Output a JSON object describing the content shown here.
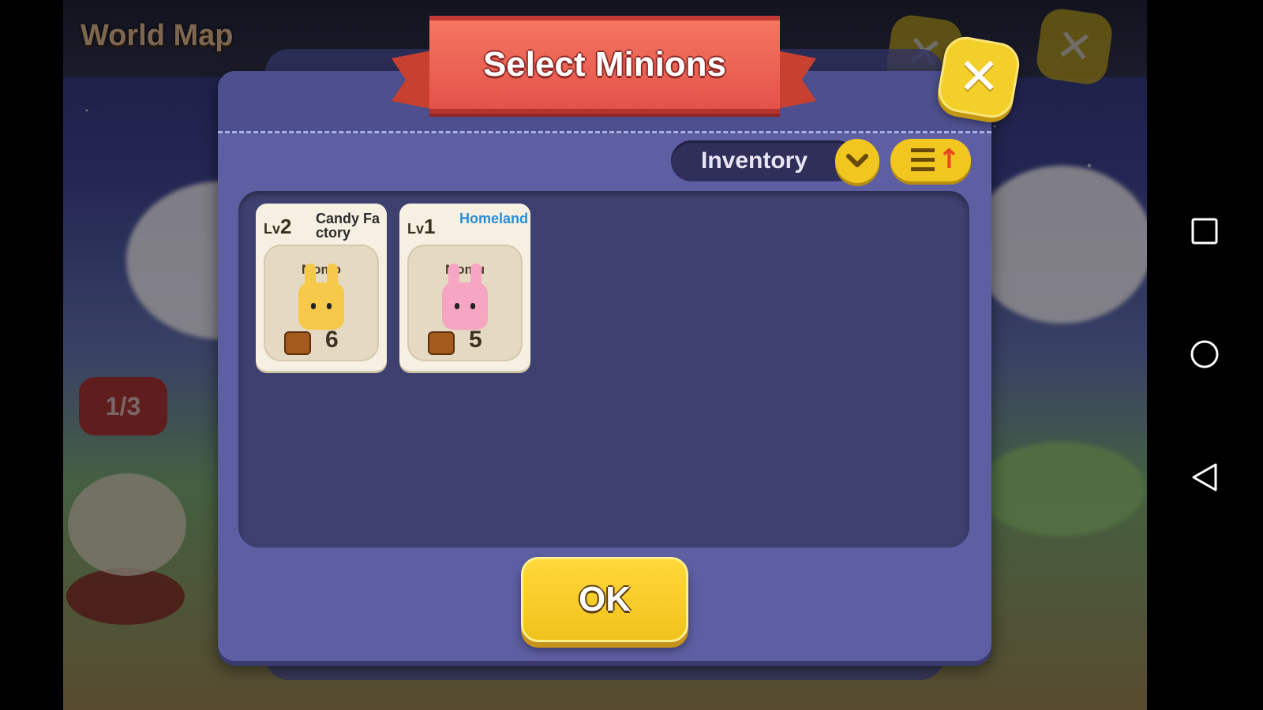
{
  "background": {
    "header_title": "World Map",
    "page_indicator": "1/3",
    "close_icon": "close-icon"
  },
  "dialog": {
    "title": "Select Minions",
    "close_icon": "close-icon",
    "filter": {
      "selected": "Inventory",
      "dropdown_icon": "chevron-down-icon"
    },
    "sort_icon": "sort-ascending-icon",
    "minions": [
      {
        "level_prefix": "Lv",
        "level": "2",
        "location": "Candy Factory",
        "location_color": "#2b2b2b",
        "name": "Momo",
        "count": "6",
        "body_color": "#f6c94a",
        "icon": "treasure-chest-icon"
      },
      {
        "level_prefix": "Lv",
        "level": "1",
        "location": "Homeland",
        "location_color": "#2a8dd8",
        "name": "Momu",
        "count": "5",
        "body_color": "#f6a6c2",
        "icon": "treasure-chest-icon"
      }
    ],
    "ok_label": "OK"
  },
  "system_nav": {
    "recents_icon": "square-icon",
    "home_icon": "circle-icon",
    "back_icon": "triangle-back-icon"
  },
  "colors": {
    "ribbon": "#e4534a",
    "button_yellow": "#f1c71f",
    "panel": "#5e5fa3"
  }
}
